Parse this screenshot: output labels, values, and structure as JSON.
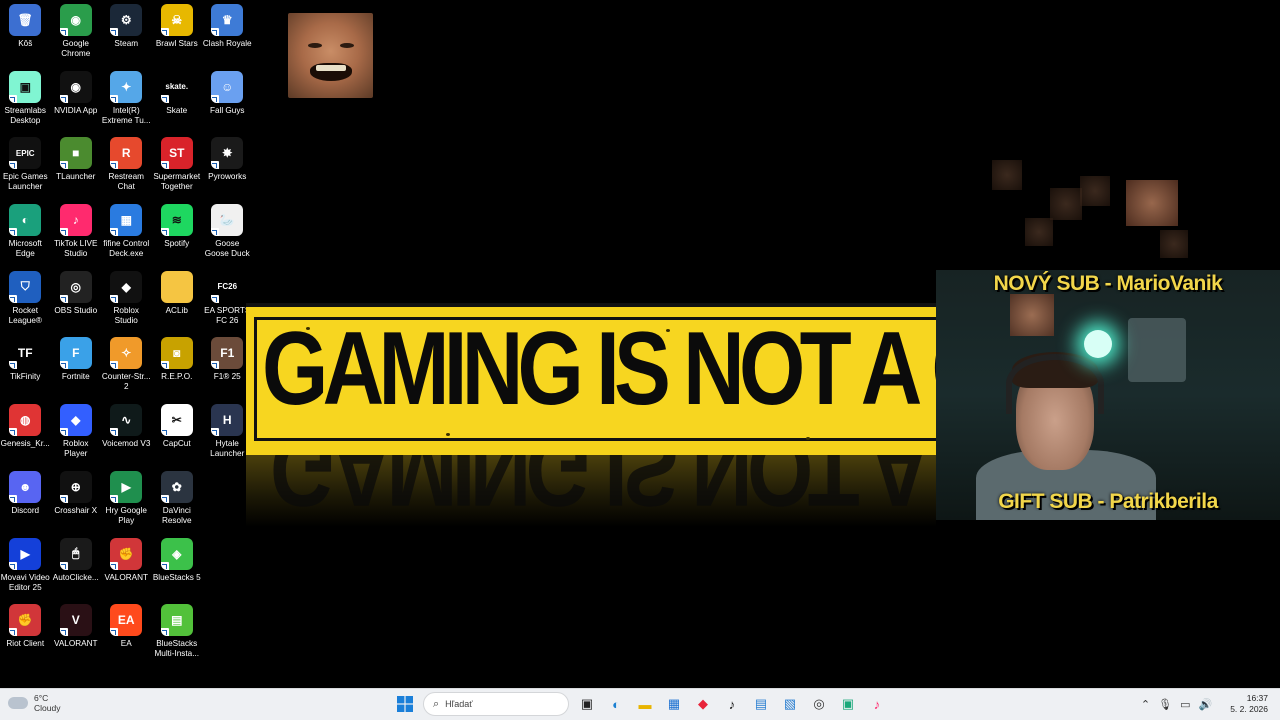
{
  "desktop_icons": [
    {
      "label": "Kôš",
      "icon": "recycle-bin-icon",
      "color": "#3c6fd1",
      "glyph": "🗑"
    },
    {
      "label": "Google Chrome",
      "icon": "chrome-icon",
      "color": "#2a9d4b",
      "glyph": "◉"
    },
    {
      "label": "Steam",
      "icon": "steam-icon",
      "color": "#1b2838",
      "glyph": "⚙"
    },
    {
      "label": "Brawl Stars",
      "icon": "brawl-stars-icon",
      "color": "#e7b800",
      "glyph": "☠"
    },
    {
      "label": "Clash Royale",
      "icon": "clash-royale-icon",
      "color": "#3e7bd6",
      "glyph": "♛"
    },
    {
      "label": "Streamlabs Desktop",
      "icon": "streamlabs-icon",
      "color": "#80f5d2",
      "glyph": "▣"
    },
    {
      "label": "NVIDIA App",
      "icon": "nvidia-icon",
      "color": "#111111",
      "glyph": "◉"
    },
    {
      "label": "Intel(R) Extreme Tu...",
      "icon": "intel-icon",
      "color": "#55a7e8",
      "glyph": "✦"
    },
    {
      "label": "Skate",
      "icon": "skate-icon",
      "color": "#000000",
      "glyph": "skate."
    },
    {
      "label": "Fall Guys",
      "icon": "fall-guys-icon",
      "color": "#6aa0f0",
      "glyph": "☺"
    },
    {
      "label": "Epic Games Launcher",
      "icon": "epic-games-icon",
      "color": "#111111",
      "glyph": "EPIC"
    },
    {
      "label": "TLauncher",
      "icon": "tlauncher-icon",
      "color": "#4b8b2f",
      "glyph": "■"
    },
    {
      "label": "Restream Chat",
      "icon": "restream-icon",
      "color": "#e6492d",
      "glyph": "R"
    },
    {
      "label": "Supermarket Together",
      "icon": "supermarket-together-icon",
      "color": "#d9232a",
      "glyph": "ST"
    },
    {
      "label": "Pyroworks",
      "icon": "pyroworks-icon",
      "color": "#1a1a1a",
      "glyph": "✸"
    },
    {
      "label": "Microsoft Edge",
      "icon": "edge-icon",
      "color": "#1aa07c",
      "glyph": "◐"
    },
    {
      "label": "TikTok LIVE Studio",
      "icon": "tiktok-live-icon",
      "color": "#ff2a6e",
      "glyph": "♪"
    },
    {
      "label": "fifine Control Deck.exe",
      "icon": "fifine-icon",
      "color": "#2a7be0",
      "glyph": "▦"
    },
    {
      "label": "Spotify",
      "icon": "spotify-icon",
      "color": "#1ed760",
      "glyph": "≋"
    },
    {
      "label": "Goose Goose Duck",
      "icon": "goose-goose-duck-icon",
      "color": "#f0f0f0",
      "glyph": "🦢"
    },
    {
      "label": "Rocket League®",
      "icon": "rocket-league-icon",
      "color": "#1f5fbf",
      "glyph": "⛉"
    },
    {
      "label": "OBS Studio",
      "icon": "obs-icon",
      "color": "#222222",
      "glyph": "◎"
    },
    {
      "label": "Roblox Studio",
      "icon": "roblox-studio-icon",
      "color": "#111111",
      "glyph": "◆"
    },
    {
      "label": "ACLib",
      "icon": "folder-icon",
      "color": "#f5c542",
      "glyph": ""
    },
    {
      "label": "EA SPORTS FC 26",
      "icon": "ea-fc-icon",
      "color": "#000000",
      "glyph": "FC26"
    },
    {
      "label": "TikFinity",
      "icon": "tikfinity-icon",
      "color": "#000000",
      "glyph": "TF"
    },
    {
      "label": "Fortnite",
      "icon": "fortnite-icon",
      "color": "#3aa1e8",
      "glyph": "F"
    },
    {
      "label": "Counter-Str... 2",
      "icon": "counter-strike-icon",
      "color": "#f09a2a",
      "glyph": "✧"
    },
    {
      "label": "R.E.P.O.",
      "icon": "repo-icon",
      "color": "#c8a200",
      "glyph": "◙"
    },
    {
      "label": "F1® 25",
      "icon": "f1-icon",
      "color": "#6b4b3a",
      "glyph": "F1"
    },
    {
      "label": "Genesis_Kr...",
      "icon": "genesis-icon",
      "color": "#e03434",
      "glyph": "◍"
    },
    {
      "label": "Roblox Player",
      "icon": "roblox-player-icon",
      "color": "#335fff",
      "glyph": "◆"
    },
    {
      "label": "Voicemod V3",
      "icon": "voicemod-icon",
      "color": "#0f1a1a",
      "glyph": "∿"
    },
    {
      "label": "CapCut",
      "icon": "capcut-icon",
      "color": "#ffffff",
      "glyph": "✂"
    },
    {
      "label": "Hytale Launcher",
      "icon": "hytale-icon",
      "color": "#2a3550",
      "glyph": "H"
    },
    {
      "label": "Discord",
      "icon": "discord-icon",
      "color": "#5865f2",
      "glyph": "☻"
    },
    {
      "label": "Crosshair X",
      "icon": "crosshair-icon",
      "color": "#111111",
      "glyph": "⊕"
    },
    {
      "label": "Hry Google Play",
      "icon": "google-play-icon",
      "color": "#1f8f4e",
      "glyph": "▶"
    },
    {
      "label": "DaVinci Resolve",
      "icon": "davinci-icon",
      "color": "#2b3440",
      "glyph": "✿"
    },
    {
      "label": "",
      "icon": "",
      "color": "",
      "glyph": "",
      "empty": true
    },
    {
      "label": "Movavi Video Editor 25",
      "icon": "movavi-icon",
      "color": "#1440d9",
      "glyph": "▶"
    },
    {
      "label": "AutoClicke...",
      "icon": "autoclicker-icon",
      "color": "#1a1a1a",
      "glyph": "🖱"
    },
    {
      "label": "VALORANT",
      "icon": "valorant-riot-icon",
      "color": "#d13639",
      "glyph": "✊"
    },
    {
      "label": "BlueStacks 5",
      "icon": "bluestacks-icon",
      "color": "#3cc14a",
      "glyph": "◈"
    },
    {
      "label": "",
      "icon": "",
      "color": "",
      "glyph": "",
      "empty": true
    },
    {
      "label": "Riot Client",
      "icon": "riot-client-icon",
      "color": "#d13639",
      "glyph": "✊"
    },
    {
      "label": "VALORANT",
      "icon": "valorant-icon",
      "color": "#2a1015",
      "glyph": "V"
    },
    {
      "label": "EA",
      "icon": "ea-icon",
      "color": "#ff4a1c",
      "glyph": "EA"
    },
    {
      "label": "BlueStacks Multi-Insta...",
      "icon": "bluestacks-multi-icon",
      "color": "#52c13a",
      "glyph": "▤"
    },
    {
      "label": "",
      "icon": "",
      "color": "",
      "glyph": "",
      "empty": true
    }
  ],
  "banner": {
    "headline": "GAMING IS NOT A CRI",
    "reflection": "GAMING IS NOT A CRI"
  },
  "stream_overlay": {
    "top_alert": "NOVÝ SUB - MarioVanik",
    "bottom_alert": "GIFT SUB - Patrikberila",
    "alert_color": "#f2d64a"
  },
  "taskbar": {
    "weather_temp": "6°C",
    "weather_desc": "Cloudy",
    "search_placeholder": "Hľadať",
    "pinned": [
      {
        "name": "task-view-icon",
        "glyph": "▣",
        "color": "#222"
      },
      {
        "name": "edge-taskbar-icon",
        "glyph": "◐",
        "color": "#1a7fd1"
      },
      {
        "name": "file-explorer-icon",
        "glyph": "▬",
        "color": "#e8b400"
      },
      {
        "name": "store-icon",
        "glyph": "▦",
        "color": "#1a6fd1"
      },
      {
        "name": "app-red-diamond-icon",
        "glyph": "◆",
        "color": "#e8243a"
      },
      {
        "name": "tiktok-taskbar-icon",
        "glyph": "♪",
        "color": "#111"
      },
      {
        "name": "notepad-icon",
        "glyph": "▤",
        "color": "#2a7fd1"
      },
      {
        "name": "photos-icon",
        "glyph": "▧",
        "color": "#2a7fd1"
      },
      {
        "name": "obs-taskbar-icon",
        "glyph": "◎",
        "color": "#333"
      },
      {
        "name": "streamlabs-taskbar-icon",
        "glyph": "▣",
        "color": "#1aa87a"
      },
      {
        "name": "tiktok-live-taskbar-icon",
        "glyph": "♪",
        "color": "#ff2a6e"
      }
    ],
    "time": "16:37",
    "date": "5. 2. 2026"
  }
}
